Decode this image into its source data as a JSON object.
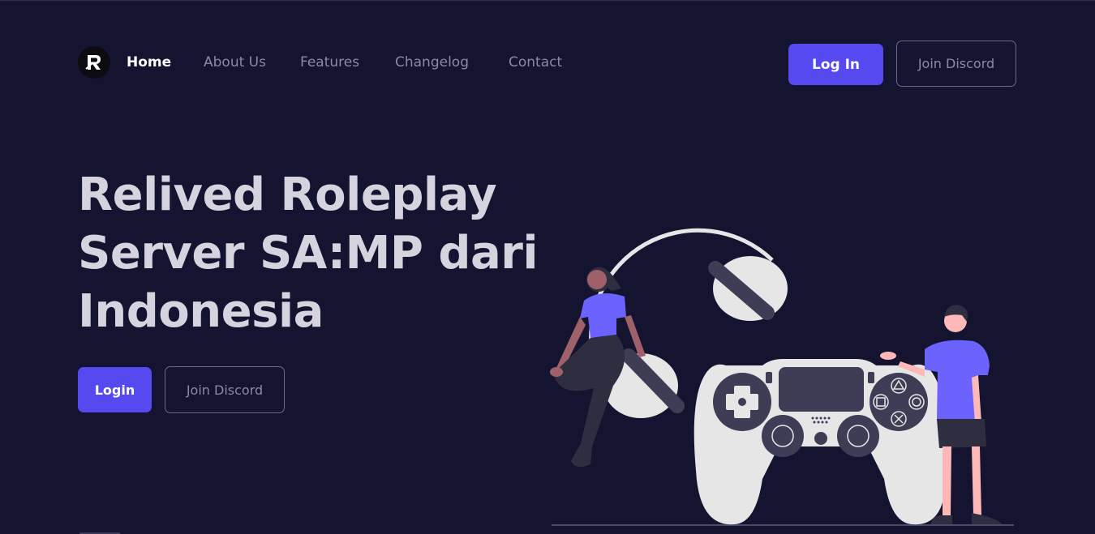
{
  "nav": {
    "logo_icon": "relived-r-logo-icon",
    "links": [
      {
        "label": "Home",
        "active": true
      },
      {
        "label": "About Us",
        "active": false
      },
      {
        "label": "Features",
        "active": false
      },
      {
        "label": "Changelog",
        "active": false
      },
      {
        "label": "Contact",
        "active": false
      }
    ],
    "login_label": "Log In",
    "discord_label": "Join Discord"
  },
  "hero": {
    "title_lines": [
      "Relived Roleplay",
      "Server SA:MP dari",
      "Indonesia"
    ],
    "login_label": "Login",
    "discord_label": "Join Discord"
  },
  "illustration": {
    "icon": "gamers-with-controller-illustration",
    "colors": {
      "accent": "#6c63ff",
      "controller": "#e6e6e6",
      "dark": "#3f3d56"
    }
  },
  "colors": {
    "background": "#141330",
    "primary_button": "#5649f0",
    "title_text": "#d4d3de",
    "muted_text": "#8a8aa6"
  }
}
